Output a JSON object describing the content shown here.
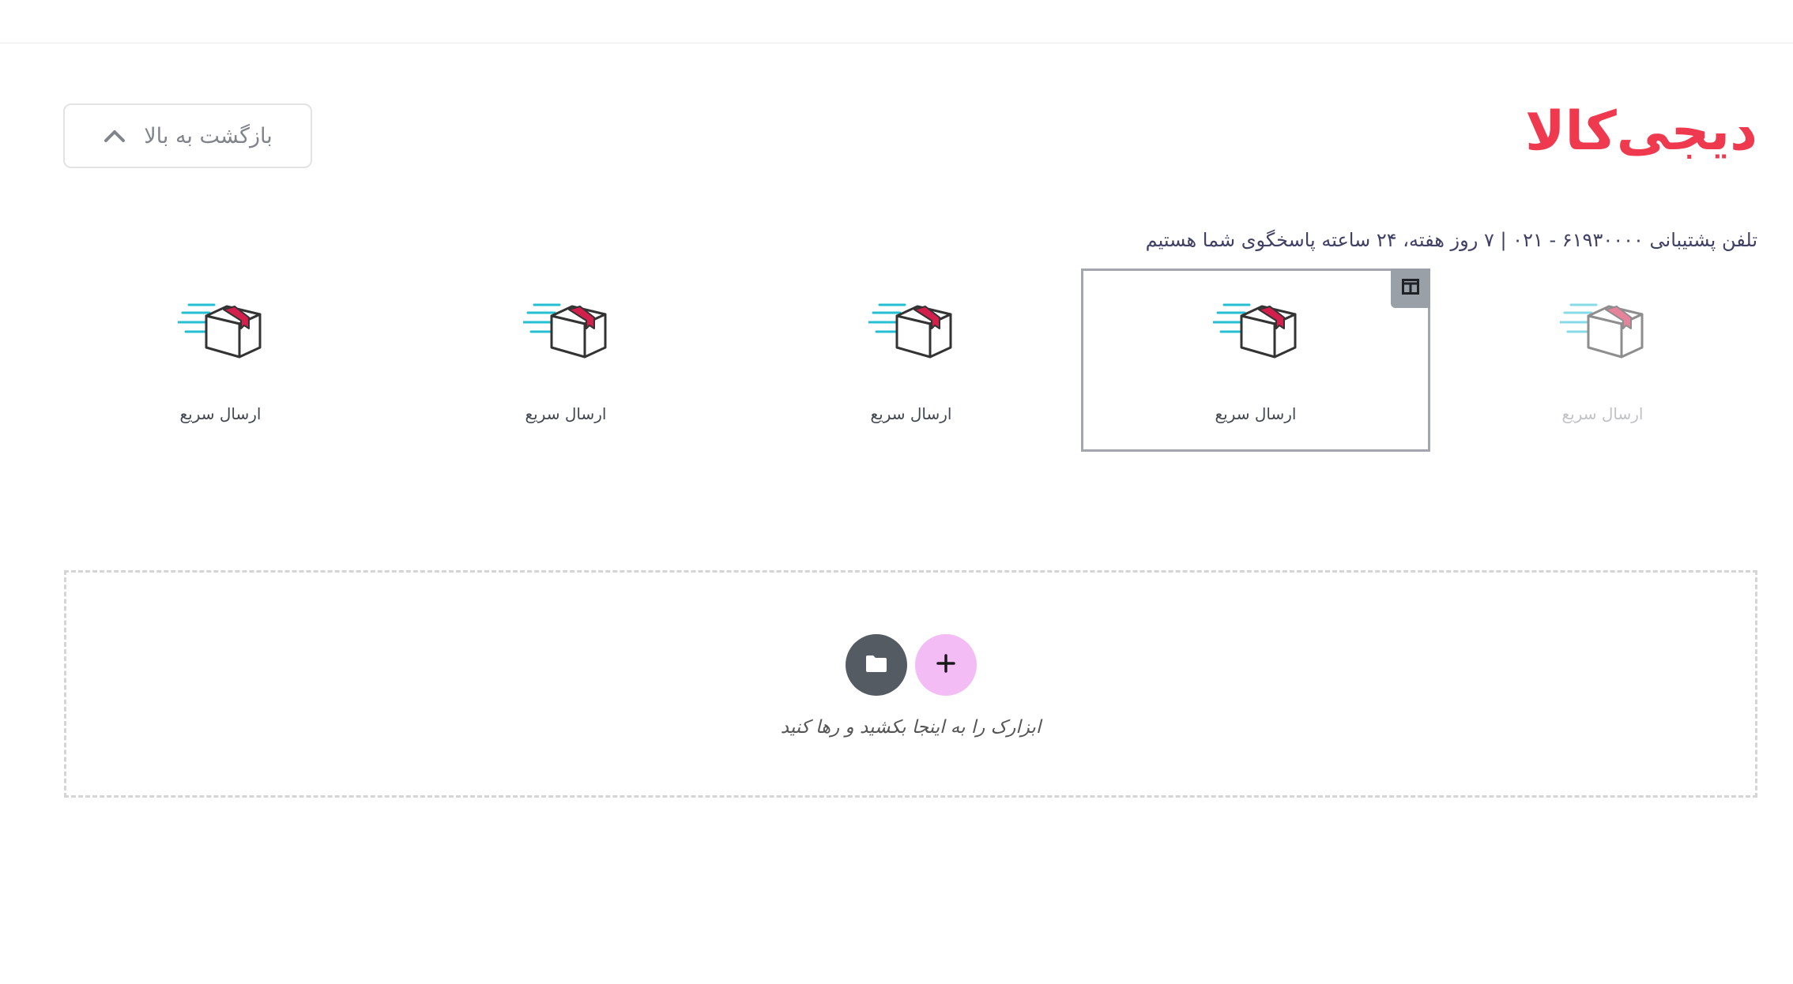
{
  "logo": {
    "text": "دیجی‌کالا",
    "color": "#ef394e"
  },
  "back_to_top": {
    "label": "بازگشت به بالا",
    "icon": "chevron-up-icon"
  },
  "support": {
    "text": "تلفن پشتیبانی ۶۱۹۳۰۰۰۰ - ۰۲۱ | ۷ روز هفته، ۲۴ ساعته پاسخگوی شما هستیم"
  },
  "features": [
    {
      "label": "ارسال سریع",
      "icon": "fast-delivery-icon",
      "state": "dim"
    },
    {
      "label": "ارسال سریع",
      "icon": "fast-delivery-icon",
      "state": "selected"
    },
    {
      "label": "ارسال سریع",
      "icon": "fast-delivery-icon",
      "state": "normal"
    },
    {
      "label": "ارسال سریع",
      "icon": "fast-delivery-icon",
      "state": "normal"
    },
    {
      "label": "ارسال سریع",
      "icon": "fast-delivery-icon",
      "state": "normal"
    }
  ],
  "editor": {
    "column_handle_icon": "column-icon",
    "drop_zone_hint": "ابزارک را به اینجا بکشید و رها کنید",
    "add_button_icon": "plus-icon",
    "template_button_icon": "folder-icon",
    "add_button_color": "#f3bcf5",
    "template_button_color": "#555b62"
  }
}
